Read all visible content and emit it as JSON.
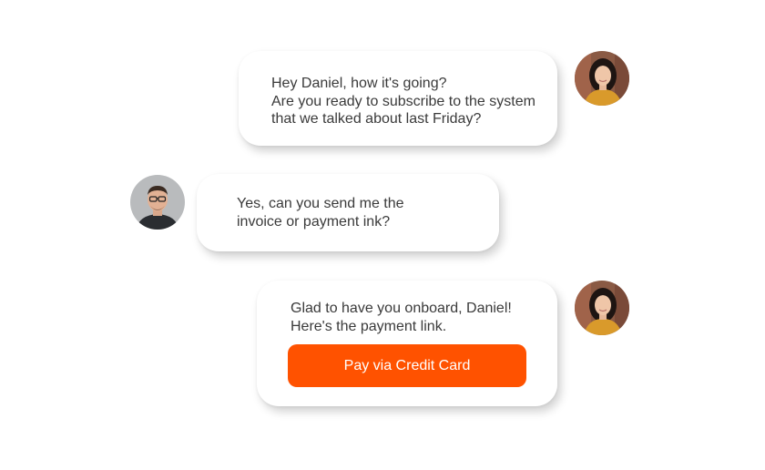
{
  "messages": [
    {
      "sender": "agent",
      "lines": [
        "Hey Daniel, how it's going?",
        "Are you ready to subscribe to the system",
        "that we talked about last Friday?"
      ]
    },
    {
      "sender": "customer",
      "lines": [
        "Yes, can you send me the",
        "invoice or payment ink?"
      ]
    },
    {
      "sender": "agent",
      "lines": [
        "Glad to have you onboard, Daniel!",
        "Here's the payment link."
      ],
      "button_label": "Pay via Credit Card"
    }
  ],
  "colors": {
    "accent": "#ff5200",
    "bubble_bg": "#ffffff",
    "text": "#3a3a3a"
  }
}
